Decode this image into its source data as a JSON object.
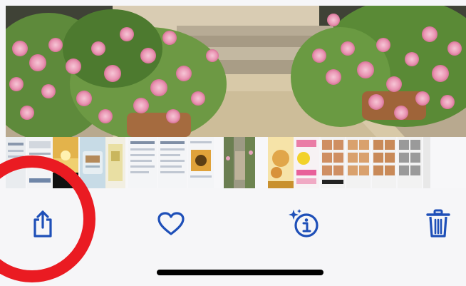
{
  "photo": {
    "description_hidden": ""
  },
  "thumbnail_strip": {
    "selected_index": 4
  },
  "toolbar": {
    "buttons": [
      {
        "icon": "share-icon"
      },
      {
        "icon": "heart-icon"
      },
      {
        "icon": "visual-lookup-icon"
      },
      {
        "icon": "trash-icon"
      }
    ],
    "accent_color": "#1e4fb8"
  },
  "annotation": {
    "color": "#ea1b22",
    "target": "share-button"
  }
}
